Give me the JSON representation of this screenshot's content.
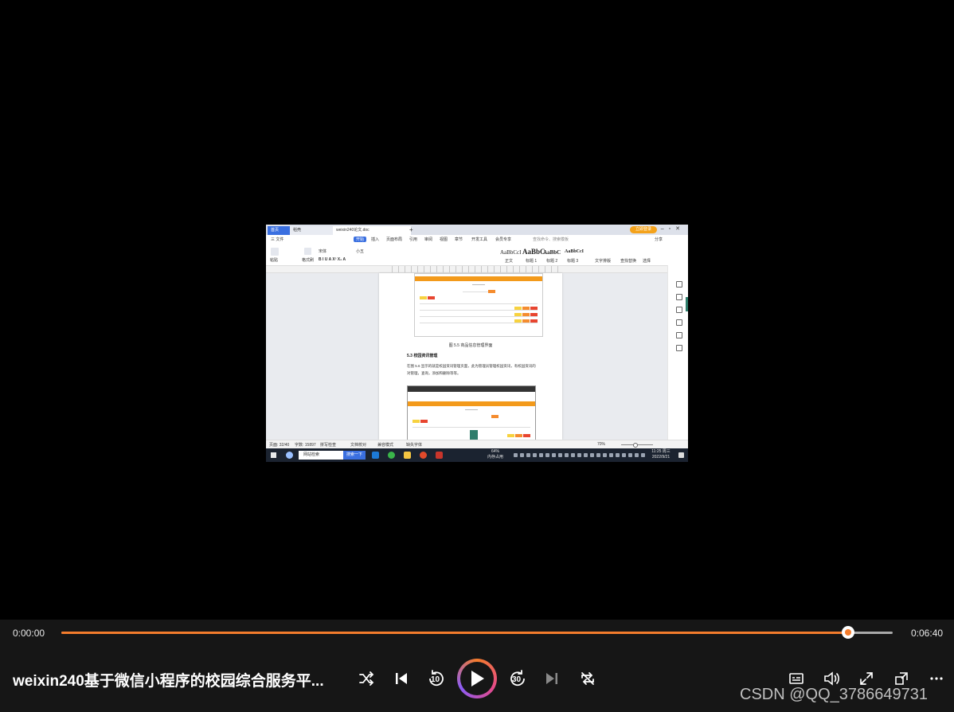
{
  "video": {
    "wps": {
      "tabs": {
        "home": "首页",
        "shell": "稻壳",
        "doc": "weixin240论文.doc"
      },
      "login": "立即登录",
      "menu": [
        "三 文件",
        "开始",
        "插入",
        "页面布局",
        "引用",
        "审阅",
        "视图",
        "章节",
        "开发工具",
        "会员专享"
      ],
      "menu_active": "开始",
      "search": "查找命令、搜索模板",
      "share": "分享",
      "ribbon": {
        "paste": "粘贴",
        "format_painter": "格式刷",
        "font": "宋体",
        "size": "小五",
        "styles": [
          "AaBbCcI",
          "AaBbC",
          "AaBbC",
          "AaBbCcI"
        ],
        "style_names": [
          "正文",
          "标题 1",
          "标题 2",
          "标题 3"
        ],
        "text_layout": "文字排版",
        "find_replace": "查找替换",
        "select": "选择"
      },
      "doc": {
        "figure_caption": "图 5.5 商品信息管理界面",
        "section_heading": "5.3 校园资讯管理",
        "paragraph": "在图 5.6 显示的就是校园资讯管理页面，此为管理员管理校园资讯，有校园资讯的对管理，查询，添加和删除等等。"
      },
      "status": {
        "page": "页面: 32/40",
        "words": "字数: 15897",
        "spell": "拼写检查",
        "proof": "文档校对",
        "compat": "兼容模式",
        "missing_font": "缺失字体",
        "zoom": "70%"
      }
    },
    "taskbar": {
      "search_placeholder": "网站检索",
      "search_button": "搜索一下",
      "cpu": "64%",
      "cpu_label": "内存占用",
      "time": "11:25 周三",
      "date": "2022/9/21"
    }
  },
  "player": {
    "current_time": "0:00:00",
    "total_time": "0:06:40",
    "progress": 0.946,
    "title": "weixin240基于微信小程序的校园综合服务平...",
    "accent_color": "#f47c2c",
    "controls": [
      "shuffle-icon",
      "previous-icon",
      "rewind-10-icon",
      "play-icon",
      "forward-30-icon",
      "next-icon",
      "repeat-icon",
      "subtitles-icon",
      "volume-icon",
      "fullscreen-icon",
      "miniplayer-icon",
      "more-icon"
    ],
    "rewind_label": "10",
    "forward_label": "30"
  },
  "watermark": "CSDN @QQ_3786649731"
}
